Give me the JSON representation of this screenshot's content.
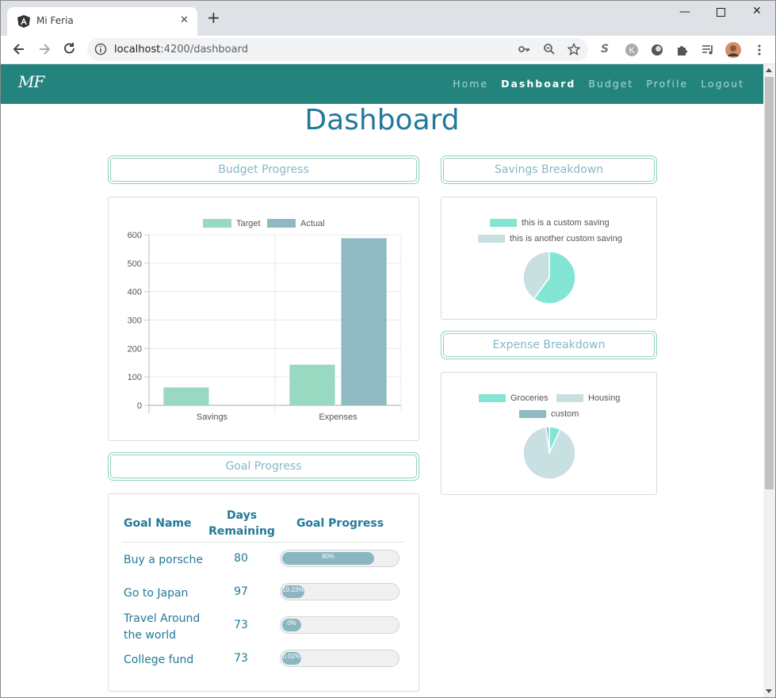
{
  "browser": {
    "tab_title": "Mi Feria",
    "url_host": "localhost",
    "url_rest": ":4200/dashboard"
  },
  "navbar": {
    "brand": "MF",
    "links": [
      {
        "label": "Home",
        "active": false
      },
      {
        "label": "Dashboard",
        "active": true
      },
      {
        "label": "Budget",
        "active": false
      },
      {
        "label": "Profile",
        "active": false
      },
      {
        "label": "Logout",
        "active": false
      }
    ]
  },
  "page_title": "Dashboard",
  "sections": {
    "budget_progress": "Budget Progress",
    "savings_breakdown": "Savings Breakdown",
    "expense_breakdown": "Expense Breakdown",
    "goal_progress": "Goal Progress"
  },
  "colors": {
    "navbar": "#23847e",
    "title": "#23799a",
    "target": "#99d9c2",
    "actual": "#8fbac1",
    "custom_saving": "#83e5d4",
    "another_saving": "#c9e0e3",
    "groceries": "#83e5d4",
    "housing": "#c9e0e3",
    "custom": "#8fbac1"
  },
  "chart_data": [
    {
      "type": "bar",
      "categories": [
        "Savings",
        "Expenses"
      ],
      "series": [
        {
          "name": "Target",
          "values": [
            63,
            143
          ]
        },
        {
          "name": "Actual",
          "values": [
            0,
            588
          ]
        }
      ],
      "ylim": [
        0,
        600
      ],
      "yticks": [
        0,
        100,
        200,
        300,
        400,
        500,
        600
      ],
      "legend": "top"
    },
    {
      "type": "pie",
      "labels": [
        "this is a custom saving",
        "this is another custom saving"
      ],
      "values": [
        60,
        40
      ],
      "legend": "top"
    },
    {
      "type": "pie",
      "labels": [
        "Groceries",
        "Housing",
        "custom"
      ],
      "values": [
        7,
        91,
        2
      ],
      "legend": "top"
    }
  ],
  "goal_table": {
    "headers": {
      "name": "Goal Name",
      "days": "Days Remaining",
      "progress": "Goal Progress"
    },
    "rows": [
      {
        "name": "Buy a porsche",
        "days": "80",
        "progress": 80,
        "label": "80%"
      },
      {
        "name": "Go to Japan",
        "days": "97",
        "progress": 19.23,
        "label": "19.23%"
      },
      {
        "name": "Travel Around the world",
        "days": "73",
        "progress": 0,
        "label": "0%"
      },
      {
        "name": "College fund",
        "days": "73",
        "progress": 0.02,
        "label": "0.02%"
      }
    ]
  }
}
